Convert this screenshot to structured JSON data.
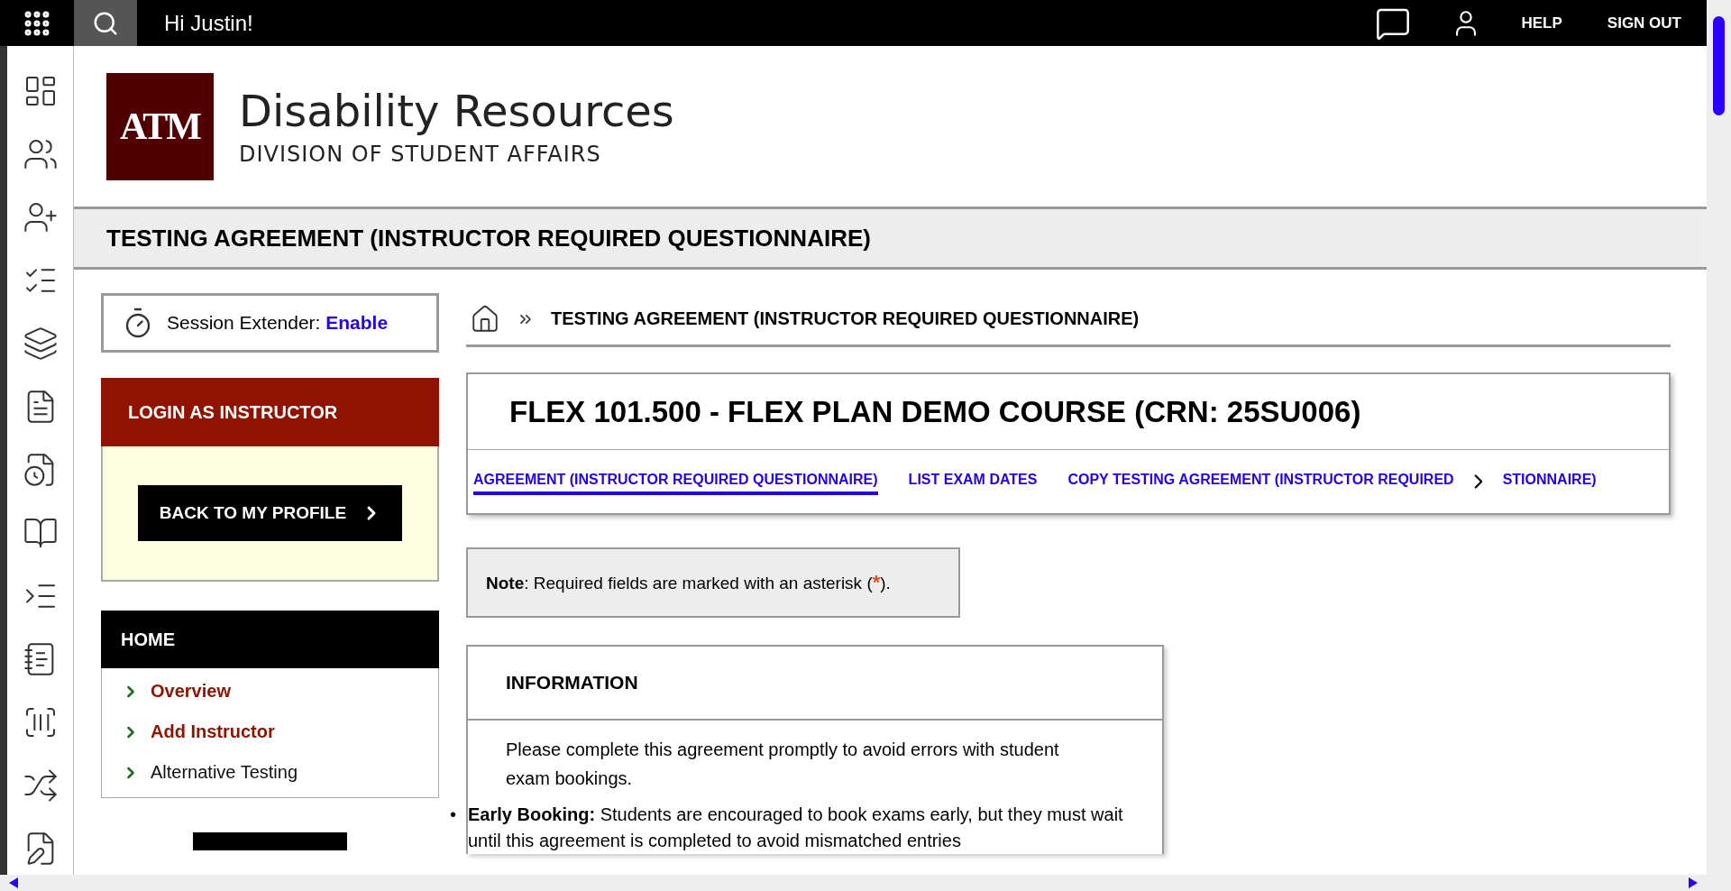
{
  "top_bar": {
    "greeting": "Hi Justin!",
    "links": [
      "HELP",
      "SIGN OUT"
    ]
  },
  "brand": {
    "mark": "ATM",
    "title": "Disability Resources",
    "subtitle": "DIVISION OF STUDENT AFFAIRS"
  },
  "page_title": "TESTING AGREEMENT (INSTRUCTOR REQUIRED QUESTIONNAIRE)",
  "session_extender": {
    "label": "Session Extender:",
    "action": "Enable"
  },
  "login_panel": {
    "title": "LOGIN AS INSTRUCTOR",
    "button": "BACK TO MY PROFILE"
  },
  "home_menu": {
    "title": "HOME",
    "items": [
      {
        "label": "Overview",
        "highlighted": true
      },
      {
        "label": "Add Instructor",
        "highlighted": true
      },
      {
        "label": "Alternative Testing",
        "highlighted": false
      }
    ]
  },
  "breadcrumb": {
    "current": "TESTING AGREEMENT (INSTRUCTOR REQUIRED QUESTIONNAIRE)"
  },
  "course": {
    "title": "FLEX 101.500 - FLEX PLAN DEMO COURSE (CRN: 25SU006)",
    "tabs": [
      {
        "label": "AGREEMENT (INSTRUCTOR REQUIRED QUESTIONNAIRE)",
        "selected": true
      },
      {
        "label": "LIST EXAM DATES",
        "selected": false
      },
      {
        "label": "COPY TESTING AGREEMENT (INSTRUCTOR REQUIRED",
        "selected": false
      }
    ],
    "tab_fragment": "STIONNAIRE)"
  },
  "note": {
    "before": "**Note**: Required fields are marked with an asterisk (",
    "asterisk": "*",
    "after": ")."
  },
  "information": {
    "title": "INFORMATION",
    "intro": "Please complete this agreement promptly to avoid errors with student exam bookings.",
    "bullets": [
      {
        "marker": "•",
        "text": "**Early Booking:** Students are encouraged to book exams early, but they must wait until this agreement is completed to avoid mismatched entries"
      }
    ]
  }
}
